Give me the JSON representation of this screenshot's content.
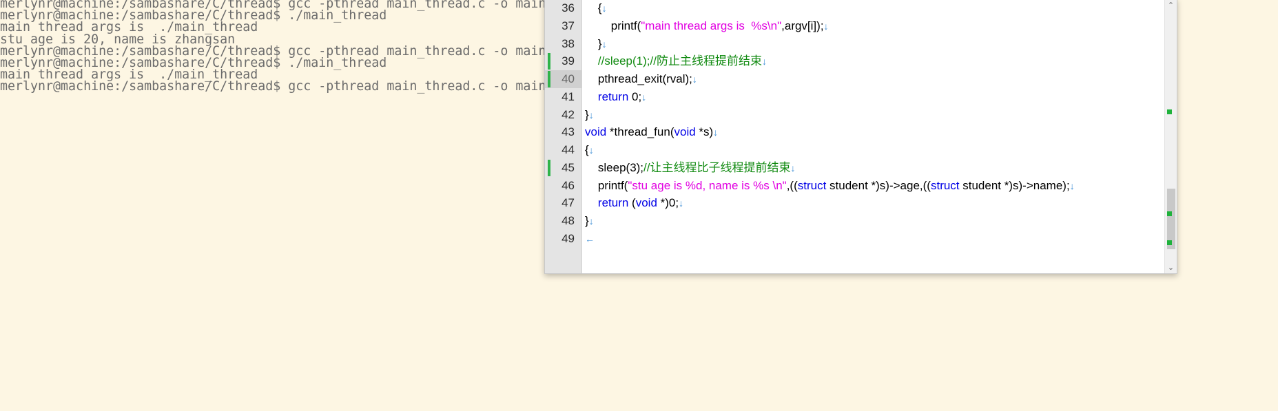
{
  "terminal": {
    "lines": [
      "merlynr@machine:/sambashare/C/thread$ gcc -pthread main_thread.c -o main_thread",
      "merlynr@machine:/sambashare/C/thread$ ./main_thread",
      "main thread args is  ./main_thread",
      "stu age is 20, name is zhangsan",
      "merlynr@machine:/sambashare/C/thread$ gcc -pthread main_thread.c -o main_thread",
      "merlynr@machine:/sambashare/C/thread$ ./main_thread",
      "main thread args is  ./main_thread",
      "merlynr@machine:/sambashare/C/thread$ gcc -pthread main_thread.c -o main_thread"
    ]
  },
  "editor": {
    "current_line": "40",
    "changed_lines": [
      "39",
      "40",
      "45"
    ],
    "line_numbers": [
      "36",
      "37",
      "38",
      "39",
      "40",
      "41",
      "42",
      "43",
      "44",
      "45",
      "46",
      "47",
      "48",
      "49"
    ],
    "newline_glyph": "↓",
    "eof_glyph": "←",
    "lines": [
      [
        {
          "t": "    {"
        }
      ],
      [
        {
          "t": "        printf("
        },
        {
          "t": "\"main thread args is  %s\\n\"",
          "c": "str"
        },
        {
          "t": ",argv[i]);"
        }
      ],
      [
        {
          "t": "    }"
        }
      ],
      [
        {
          "t": "    "
        },
        {
          "t": "//sleep(1);//防止主线程提前结束",
          "c": "cm"
        }
      ],
      [
        {
          "t": "    pthread_exit(rval);"
        }
      ],
      [
        {
          "t": "    "
        },
        {
          "t": "return",
          "c": "kw"
        },
        {
          "t": " 0;"
        }
      ],
      [
        {
          "t": "}"
        }
      ],
      [
        {
          "t": "void",
          "c": "kw"
        },
        {
          "t": " *thread_fun("
        },
        {
          "t": "void",
          "c": "kw"
        },
        {
          "t": " *s)"
        }
      ],
      [
        {
          "t": "{"
        }
      ],
      [
        {
          "t": "    sleep(3);"
        },
        {
          "t": "//让主线程比子线程提前结束",
          "c": "cm"
        }
      ],
      [
        {
          "t": "    printf("
        },
        {
          "t": "\"stu age is %d, name is %s \\n\"",
          "c": "str"
        },
        {
          "t": ",(("
        },
        {
          "t": "struct",
          "c": "kw"
        },
        {
          "t": " student *)s)->age,(("
        },
        {
          "t": "struct",
          "c": "kw"
        },
        {
          "t": " student *)s)->name);"
        }
      ],
      [
        {
          "t": "    "
        },
        {
          "t": "return",
          "c": "kw"
        },
        {
          "t": " ("
        },
        {
          "t": "void",
          "c": "kw"
        },
        {
          "t": " *)0;"
        }
      ],
      [
        {
          "t": "}"
        }
      ],
      []
    ],
    "scrollbar": {
      "up_glyph": "⌃",
      "down_glyph": "⌄",
      "thumb_fraction_start": 0.71,
      "thumb_fraction_end": 0.95
    }
  },
  "colors": {
    "background": "#fdf6e3",
    "terminal_text": "#6c6c6c",
    "keyword": "#0000e6",
    "string": "#e100e1",
    "comment": "#108a10",
    "newline_glyph": "#3f8fd6",
    "change_marker": "#2fb34a"
  }
}
